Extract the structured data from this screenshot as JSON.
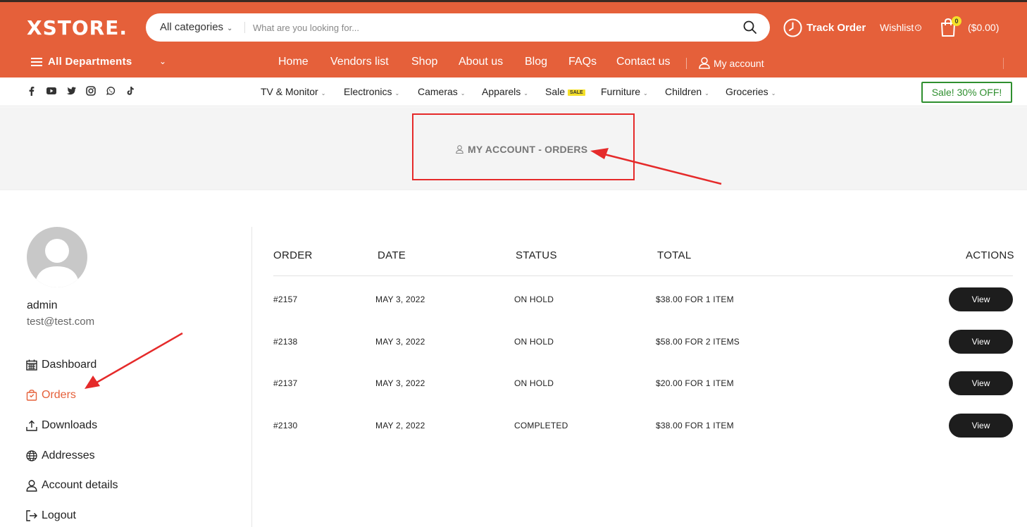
{
  "header": {
    "logo": "XSTORE.",
    "search": {
      "category": "All categories",
      "placeholder": "What are you looking for..."
    },
    "track_order": "Track Order",
    "wishlist": "Wishlist",
    "cart": {
      "count": "0",
      "total": "($0.00)"
    },
    "departments": "All Departments",
    "nav": [
      "Home",
      "Vendors list",
      "Shop",
      "About us",
      "Blog",
      "FAQs",
      "Contact us"
    ],
    "my_account": "My account"
  },
  "category_bar": {
    "social_icons": [
      "facebook-icon",
      "youtube-icon",
      "twitter-icon",
      "instagram-icon",
      "whatsapp-icon",
      "tiktok-icon"
    ],
    "items": [
      "TV & Monitor",
      "Electronics",
      "Cameras",
      "Apparels",
      "Sale",
      "Furniture",
      "Children",
      "Groceries"
    ],
    "sale_badge": "SALE",
    "promo": "Sale! 30% OFF!"
  },
  "page_title": "MY ACCOUNT - ORDERS",
  "account": {
    "name": "admin",
    "email": "test@test.com",
    "menu": [
      "Dashboard",
      "Orders",
      "Downloads",
      "Addresses",
      "Account details",
      "Logout"
    ],
    "active_item": "Orders"
  },
  "orders": {
    "columns": [
      "ORDER",
      "DATE",
      "STATUS",
      "TOTAL",
      "ACTIONS"
    ],
    "rows": [
      {
        "order": "#2157",
        "date": "MAY 3, 2022",
        "status": "ON HOLD",
        "total": "$38.00 FOR 1 ITEM",
        "action": "View"
      },
      {
        "order": "#2138",
        "date": "MAY 3, 2022",
        "status": "ON HOLD",
        "total": "$58.00 FOR 2 ITEMS",
        "action": "View"
      },
      {
        "order": "#2137",
        "date": "MAY 3, 2022",
        "status": "ON HOLD",
        "total": "$20.00 FOR 1 ITEM",
        "action": "View"
      },
      {
        "order": "#2130",
        "date": "MAY 2, 2022",
        "status": "COMPLETED",
        "total": "$38.00 FOR 1 ITEM",
        "action": "View"
      }
    ]
  },
  "colors": {
    "brand": "#e5603a",
    "annotation": "#e52a2a",
    "promo": "#2f8f2f",
    "button": "#1d1d1d"
  }
}
